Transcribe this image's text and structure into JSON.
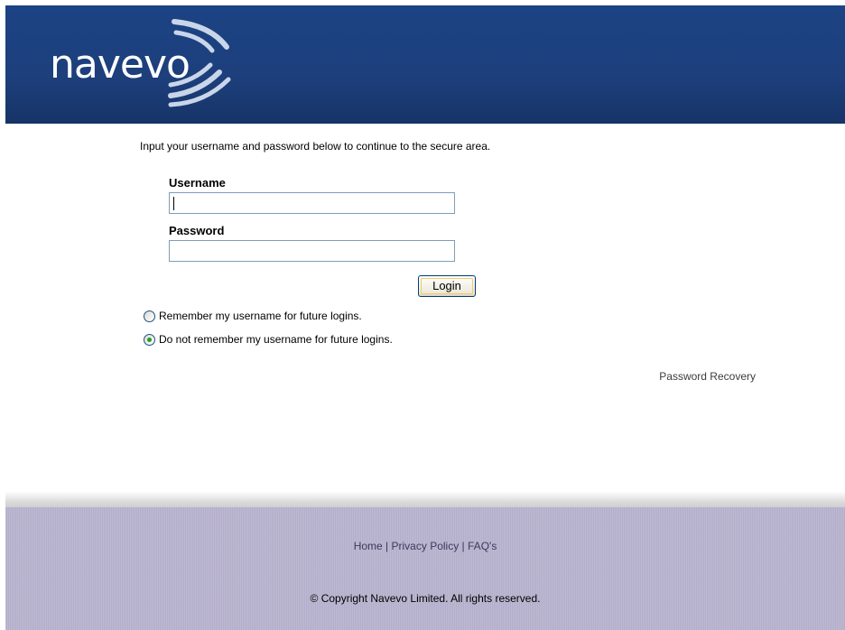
{
  "header": {
    "logo_text": "navevo",
    "brand_color": "#1d3f7c"
  },
  "main": {
    "intro": "Input your username and password below to continue to the secure area.",
    "username_label": "Username",
    "username_value": "",
    "password_label": "Password",
    "password_value": "",
    "login_label": "Login",
    "remember_options": [
      {
        "label": "Remember my username for future logins.",
        "checked": false
      },
      {
        "label": "Do not remember my username for future logins.",
        "checked": true
      }
    ],
    "recovery_link": "Password Recovery"
  },
  "footer": {
    "links": [
      "Home",
      "Privacy Policy",
      "FAQ's"
    ],
    "separator": "|",
    "copyright": "© Copyright Navevo Limited. All rights reserved.",
    "background_color": "#b9b3cf"
  }
}
